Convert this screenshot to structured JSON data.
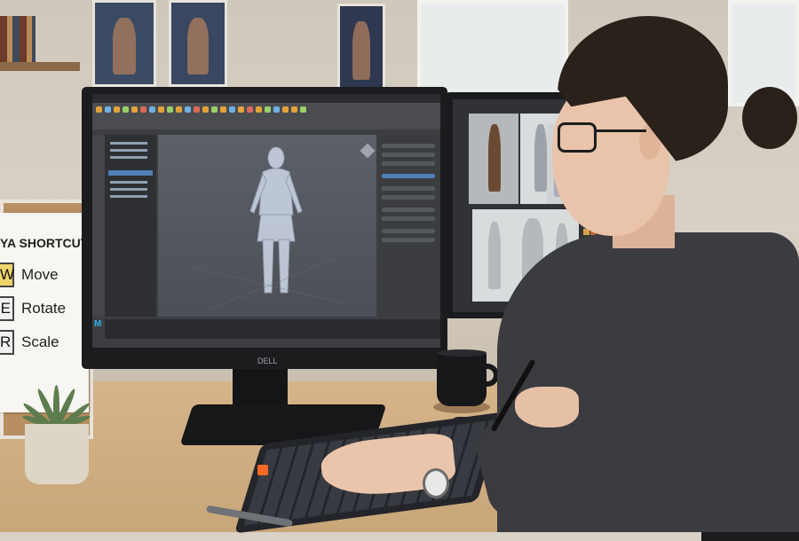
{
  "scene": {
    "description_kind": "photo",
    "shortcut_sheet": {
      "title": "YA SHORTCUTS",
      "items": [
        {
          "key": "W",
          "action": "Move",
          "highlight": true
        },
        {
          "key": "E",
          "action": "Rotate",
          "highlight": false
        },
        {
          "key": "R",
          "action": "Scale",
          "highlight": false
        }
      ]
    },
    "monitor_brand": "DELL",
    "app_logo": "M",
    "icons": {
      "maya": "maya-logo-icon",
      "viewcube": "viewcube-icon"
    },
    "colors": {
      "accent_orange": "#ff6a22",
      "selection_blue": "#4f7fb6",
      "sweater": "#3b3c40",
      "desk": "#d6b48a"
    }
  }
}
